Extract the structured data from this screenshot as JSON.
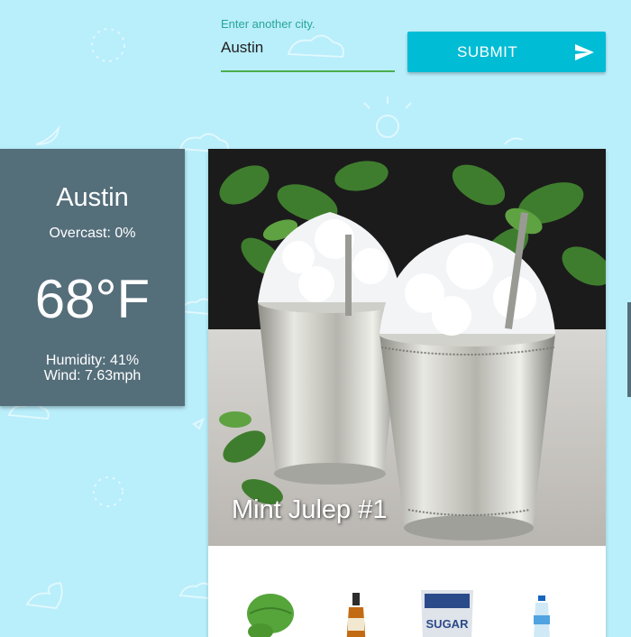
{
  "search": {
    "label": "Enter another city.",
    "value": "Austin"
  },
  "submit": {
    "label": "SUBMIT",
    "icon": "send-icon"
  },
  "weather": {
    "city": "Austin",
    "overcast": "Overcast: 0%",
    "temperature": "68°F",
    "humidity": "Humidity: 41%",
    "wind": "Wind: 7.63mph"
  },
  "drink": {
    "title": "Mint Julep #1",
    "ingredients": [
      {
        "icon": "mint-leaves-icon"
      },
      {
        "icon": "bourbon-bottle-icon"
      },
      {
        "icon": "powdered-sugar-bag-icon",
        "label": "SUGAR"
      },
      {
        "icon": "water-bottle-icon"
      }
    ]
  },
  "colors": {
    "background": "#b9eefb",
    "accent": "#00bcd4",
    "weather_card": "#546e7a",
    "input_underline": "#4caf50",
    "label": "#26a69a"
  }
}
